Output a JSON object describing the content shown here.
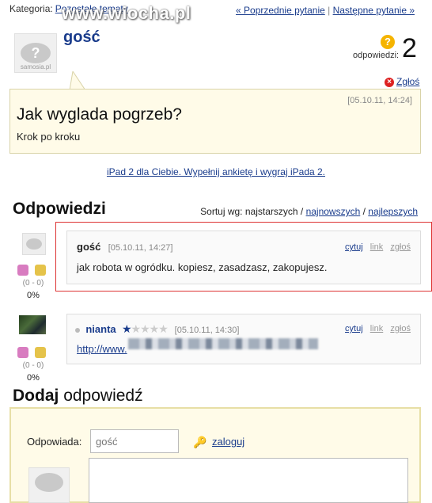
{
  "top": {
    "category_label": "Kategoria:",
    "category_link": "Pozostałe tematy",
    "watermark": "www.wiocha.pl",
    "prev_link": "« Poprzednie pytanie",
    "separator": "|",
    "next_link": "Następne pytanie »"
  },
  "asker": {
    "name": "gość",
    "avatar_site": "samosia.pl",
    "avatar_glyph": "?"
  },
  "answers_count": {
    "label": "odpowiedzi:",
    "value": "2",
    "icon": "question-badge-icon"
  },
  "report": {
    "label": "Zgłoś",
    "icon": "close-circle-icon"
  },
  "question": {
    "date": "[05.10.11, 14:24]",
    "title": "Jak wyglada pogrzeb?",
    "description": "Krok po kroku"
  },
  "promo_link": "iPad 2 dla Ciebie. Wypełnij ankietę i wygraj iPada 2.",
  "answers_section": {
    "heading": "Odpowiedzi",
    "sort_label": "Sortuj wg: najstarszych /",
    "sort_newest": "najnowszych",
    "sort_sep": "/",
    "sort_best": "najlepszych"
  },
  "answers": [
    {
      "author": "gość",
      "date": "[05.10.11, 14:27]",
      "text": "jak robota w ogródku. kopiesz, zasadzasz, zakopujesz.",
      "actions": {
        "quote": "cytuj",
        "link": "link",
        "report": "zgłoś"
      },
      "votes": "(0 - 0)",
      "percent": "0%"
    },
    {
      "author": "nianta",
      "date": "[05.10.11, 14:30]",
      "text": "http://www.",
      "stars_filled": 1,
      "stars_total": 5,
      "actions": {
        "quote": "cytuj",
        "link": "link",
        "report": "zgłoś"
      },
      "votes": "(0 - 0)",
      "percent": "0%"
    }
  ],
  "add_answer": {
    "heading_bold": "Dodaj",
    "heading_rest": "odpowiedź",
    "responder_label": "Odpowiada:",
    "name_placeholder": "gość",
    "login_link": "zaloguj"
  },
  "colors": {
    "link": "#1a3c8c",
    "question_bg": "#fffbe8",
    "answer_highlight_border": "#dd3333",
    "star": "#1a3c8c"
  }
}
